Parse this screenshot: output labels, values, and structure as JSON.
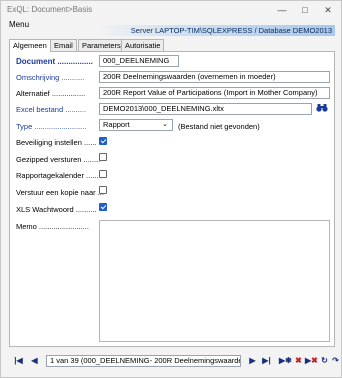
{
  "window": {
    "title": "ExQL: Document>Basis"
  },
  "menu": {
    "label": "Menu"
  },
  "server_info": "Server LAPTOP-TIM\\SQLEXPRESS / Database DEMO2013",
  "tabs": [
    "Algemeen",
    "Email",
    "Parameters",
    "Autorisatie"
  ],
  "form": {
    "document": {
      "label": "Document ................",
      "value": "000_DEELNEMING"
    },
    "omschrijving": {
      "label": "Omschrijving ...........",
      "value": "200R Deelnemingswaarden (overnemen in moeder)"
    },
    "alternatief": {
      "label": "Alternatief ................",
      "value": "200R Report Value of Participations (Import in Mother Company)"
    },
    "excel_bestand": {
      "label": "Excel bestand ..........",
      "value": "DEMO2013\\000_DEELNEMING.xltx"
    },
    "type": {
      "label": "Type .........................",
      "value": "Rapport",
      "note": "(Bestand niet gevonden)"
    },
    "beveiliging": {
      "label": "Beveiliging instellen ......",
      "checked": true
    },
    "gezipped": {
      "label": "Gezipped versturen ........",
      "checked": false
    },
    "rapportagekalender": {
      "label": "Rapportagekalender ......",
      "checked": false
    },
    "verstuur": {
      "label": "Verstuur een kopie naar ...",
      "checked": false
    },
    "xls_wachtwoord": {
      "label": "XLS Wachtwoord ..........",
      "checked": true
    },
    "memo": {
      "label": "Memo ........................",
      "value": ""
    }
  },
  "nav": {
    "record": "1 van 39 (000_DEELNEMING- 200R Deelnemingswaarden (",
    "icons": [
      "first-record-icon",
      "prev-record-icon",
      "next-record-icon",
      "last-record-icon",
      "new-record-icon",
      "delete-record-icon",
      "delete-all-icon",
      "undo-icon",
      "save-icon"
    ]
  }
}
